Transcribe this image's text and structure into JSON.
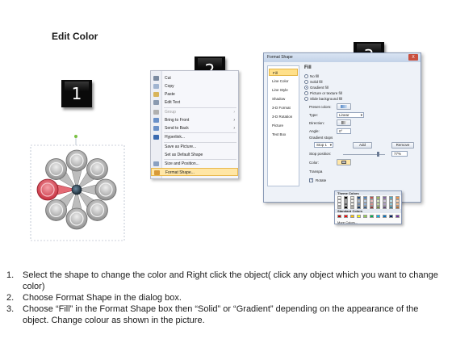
{
  "title": "Edit Color",
  "steps": [
    "1",
    "2",
    "3"
  ],
  "context_menu": {
    "items": [
      {
        "label": "Cut",
        "icon": "scissors-icon",
        "disabled": false
      },
      {
        "label": "Copy",
        "icon": "copy-icon",
        "disabled": false
      },
      {
        "label": "Paste",
        "icon": "paste-icon",
        "disabled": false
      },
      {
        "label": "Edit Text",
        "icon": "edit-text-icon",
        "disabled": false
      },
      {
        "label": "Group",
        "icon": "group-icon",
        "disabled": true,
        "submenu": true
      },
      {
        "label": "Bring to Front",
        "icon": "bring-front-icon",
        "disabled": false,
        "submenu": true
      },
      {
        "label": "Send to Back",
        "icon": "send-back-icon",
        "disabled": false,
        "submenu": true
      },
      {
        "label": "Hyperlink...",
        "icon": "hyperlink-icon",
        "disabled": false
      },
      {
        "label": "Save as Picture...",
        "icon": "",
        "disabled": false
      },
      {
        "label": "Set as Default Shape",
        "icon": "",
        "disabled": false
      },
      {
        "label": "Size and Position...",
        "icon": "size-icon",
        "disabled": false
      },
      {
        "label": "Format Shape...",
        "icon": "format-shape-icon",
        "disabled": false,
        "highlight": true
      }
    ]
  },
  "dialog": {
    "title": "Format Shape",
    "close": "X",
    "nav": [
      "Fill",
      "Line Color",
      "Line Style",
      "Shadow",
      "3-D Format",
      "3-D Rotation",
      "Picture",
      "Text Box"
    ],
    "fill_heading": "Fill",
    "radios": [
      "No fill",
      "Solid fill",
      "Gradient fill",
      "Picture or texture fill",
      "Slide background fill"
    ],
    "selected_radio": 2,
    "preset_label": "Preset colors:",
    "type_label": "Type:",
    "type_value": "Linear",
    "direction_label": "Direction:",
    "angle_label": "Angle:",
    "angle_value": "0°",
    "stops_label": "Gradient stops",
    "stop_value": "Stop 1",
    "add_label": "Add",
    "remove_label": "Remove",
    "stop_position_label": "Stop position:",
    "stop_position_value": "77%",
    "color_label": "Color:",
    "transparency_label": "Transpa",
    "rotate_label": "Rotate",
    "rotate_checked": true
  },
  "palette": {
    "theme_label": "Theme Colors",
    "standard_label": "Standard Colors",
    "more_label": "More Colors...",
    "theme_top": [
      "#ffffff",
      "#000000",
      "#eeece1",
      "#1f497d",
      "#4f81bd",
      "#c0504d",
      "#9bbb59",
      "#8064a2",
      "#4bacc6",
      "#f79646"
    ],
    "standard": [
      "#c00000",
      "#ff0000",
      "#ffc000",
      "#ffff00",
      "#92d050",
      "#00b050",
      "#00b0f0",
      "#0070c0",
      "#002060",
      "#7030a0"
    ]
  },
  "instructions": [
    {
      "num": "1.",
      "text": "Select the shape to change the color and Right click the object( click any object which you want to change color)"
    },
    {
      "num": "2.",
      "text": "Choose Format Shape in the dialog box."
    },
    {
      "num": "3.",
      "text": "Choose “Fill” in the Format Shape box then “Solid” or “Gradient” depending on the appearance of the object. Change colour as shown in the picture."
    }
  ],
  "colors": {
    "petal_gray": "#a6a6a6",
    "petal_highlight": "#d4424e",
    "menu_highlight": "#ffe6a6",
    "nav_active": "#ffe08a"
  }
}
